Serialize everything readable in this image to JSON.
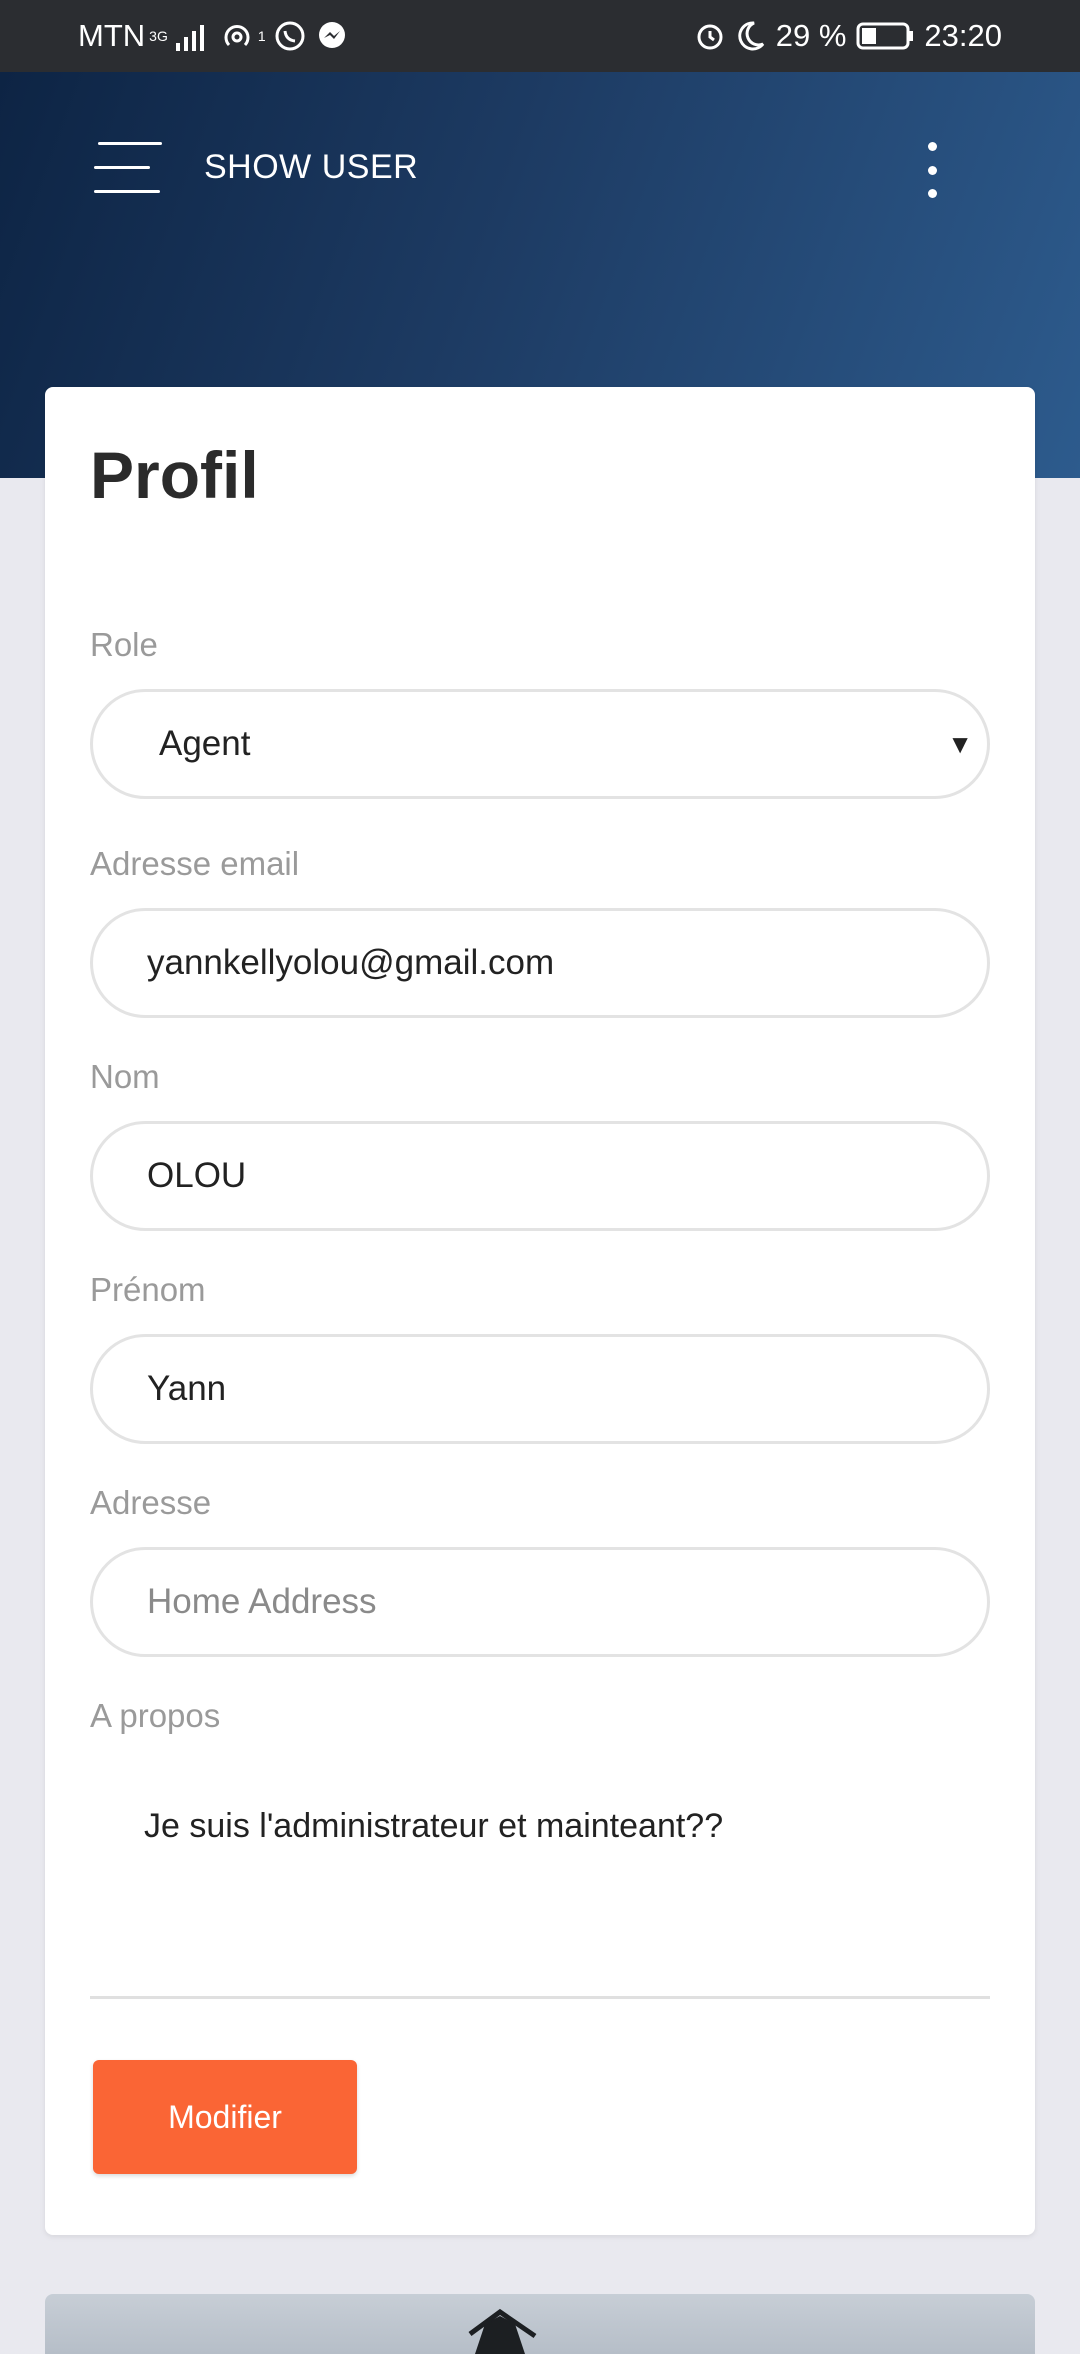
{
  "status_bar": {
    "carrier": "MTN",
    "network": "3G",
    "hotspot_count": "1",
    "battery": "29 %",
    "time": "23:20"
  },
  "header": {
    "title": "SHOW USER"
  },
  "profile": {
    "title": "Profil",
    "role_label": "Role",
    "role_value": "Agent",
    "email_label": "Adresse email",
    "email_value": "yannkellyolou@gmail.com",
    "nom_label": "Nom",
    "nom_value": "OLOU",
    "prenom_label": "Prénom",
    "prenom_value": "Yann",
    "adresse_label": "Adresse",
    "adresse_placeholder": "Home Address",
    "apropos_label": "A propos",
    "apropos_value": "Je suis l'administrateur et mainteant??",
    "submit_label": "Modifier"
  },
  "colors": {
    "header_start": "#0d2444",
    "header_end": "#2d5b8d",
    "accent": "#fa6535"
  }
}
